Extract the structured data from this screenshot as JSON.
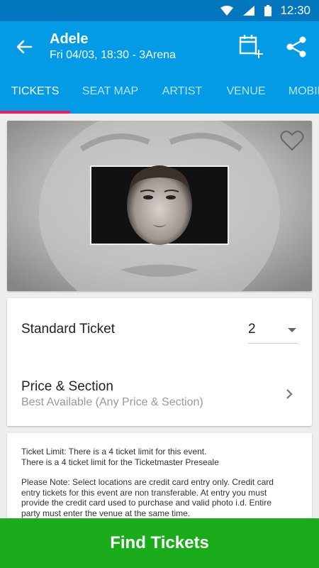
{
  "status_bar": {
    "time": "12:30"
  },
  "app_bar": {
    "title": "Adele",
    "subtitle": "Fri 04/03, 18:30 - 3Arena"
  },
  "tabs": [
    {
      "label": "TICKETS"
    },
    {
      "label": "SEAT MAP"
    },
    {
      "label": "ARTIST"
    },
    {
      "label": "VENUE"
    },
    {
      "label": "MOBILE"
    }
  ],
  "ticket_card": {
    "ticket_type_label": "Standard Ticket",
    "quantity": "2",
    "price_section_title": "Price & Section",
    "price_section_value": "Best Available (Any Price & Section)"
  },
  "info": {
    "limit_line1": "Ticket Limit: There is a 4 ticket limit for this event.",
    "limit_line2": "There is a 4 ticket limit for the Ticketmaster Preseale",
    "note_line1": "Please Note: Select locations are credit card entry only. Credit card",
    "note_line2": "entry tickets for this event are non transferable. At entry you must",
    "note_line3": "provide the credit card used to purchase and valid photo i.d. Entire",
    "note_line4": "party must enter the venue at the same time."
  },
  "find_button": {
    "label": "Find Tickets"
  },
  "colors": {
    "primary": "#039be5",
    "status": "#0277bd",
    "tab_indicator": "#e91e63",
    "cta": "#1aac1a"
  },
  "icons": [
    "wifi-icon",
    "signal-icon",
    "battery-icon",
    "back-arrow-icon",
    "add-to-calendar-icon",
    "share-icon",
    "heart-icon",
    "chevron-right-icon",
    "dropdown-caret-icon"
  ]
}
